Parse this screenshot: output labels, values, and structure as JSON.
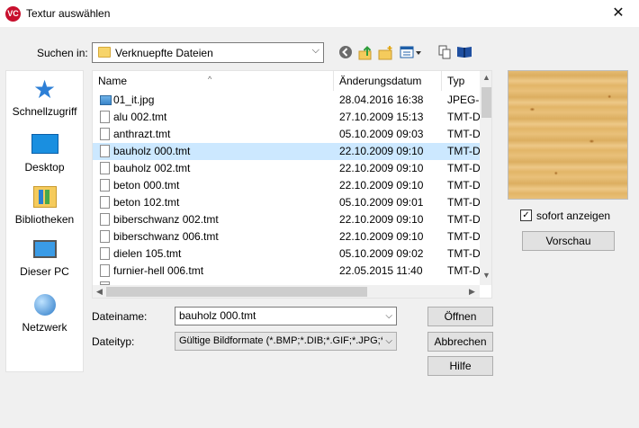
{
  "window": {
    "title": "Textur auswählen",
    "logo_text": "VC",
    "close_glyph": "✕"
  },
  "lookin": {
    "label": "Suchen in:",
    "value": "Verknuepfte Dateien"
  },
  "toolbar": {
    "icons": [
      "back-icon",
      "up-folder-icon",
      "new-folder-icon",
      "view-menu-icon",
      "copy-icon",
      "library-book-icon"
    ]
  },
  "places": [
    {
      "label": "Schnellzugriff",
      "icon": "star-icon"
    },
    {
      "label": "Desktop",
      "icon": "desktop-icon"
    },
    {
      "label": "Bibliotheken",
      "icon": "libraries-icon"
    },
    {
      "label": "Dieser PC",
      "icon": "computer-icon"
    },
    {
      "label": "Netzwerk",
      "icon": "network-icon"
    }
  ],
  "columns": {
    "name": "Name",
    "date": "Änderungsdatum",
    "type": "Typ"
  },
  "files": [
    {
      "name": "01_it.jpg",
      "date": "28.04.2016 16:38",
      "type": "JPEG-B",
      "icon": "image-file-icon"
    },
    {
      "name": "alu 002.tmt",
      "date": "27.10.2009 15:13",
      "type": "TMT-D",
      "icon": "file-icon"
    },
    {
      "name": "anthrazt.tmt",
      "date": "05.10.2009 09:03",
      "type": "TMT-D",
      "icon": "file-icon"
    },
    {
      "name": "bauholz 000.tmt",
      "date": "22.10.2009 09:10",
      "type": "TMT-D",
      "icon": "file-icon",
      "selected": true
    },
    {
      "name": "bauholz 002.tmt",
      "date": "22.10.2009 09:10",
      "type": "TMT-D",
      "icon": "file-icon"
    },
    {
      "name": "beton 000.tmt",
      "date": "22.10.2009 09:10",
      "type": "TMT-D",
      "icon": "file-icon"
    },
    {
      "name": "beton 102.tmt",
      "date": "05.10.2009 09:01",
      "type": "TMT-D",
      "icon": "file-icon"
    },
    {
      "name": "biberschwanz 002.tmt",
      "date": "22.10.2009 09:10",
      "type": "TMT-D",
      "icon": "file-icon"
    },
    {
      "name": "biberschwanz 006.tmt",
      "date": "22.10.2009 09:10",
      "type": "TMT-D",
      "icon": "file-icon"
    },
    {
      "name": "dielen 105.tmt",
      "date": "05.10.2009 09:02",
      "type": "TMT-D",
      "icon": "file-icon"
    },
    {
      "name": "furnier-hell 006.tmt",
      "date": "22.05.2015 11:40",
      "type": "TMT-D",
      "icon": "file-icon"
    }
  ],
  "filename": {
    "label": "Dateiname:",
    "value": "bauholz 000.tmt"
  },
  "filetype": {
    "label": "Dateityp:",
    "value": "Gültige Bildformate (*.BMP;*.DIB;*.GIF;*.JPG;*..."
  },
  "buttons": {
    "open": "Öffnen",
    "cancel": "Abbrechen",
    "help": "Hilfe",
    "preview": "Vorschau"
  },
  "preview_option": {
    "label": "sofort anzeigen",
    "checked": true
  },
  "colors": {
    "selection": "#cce8ff",
    "accent": "#0078d7"
  }
}
